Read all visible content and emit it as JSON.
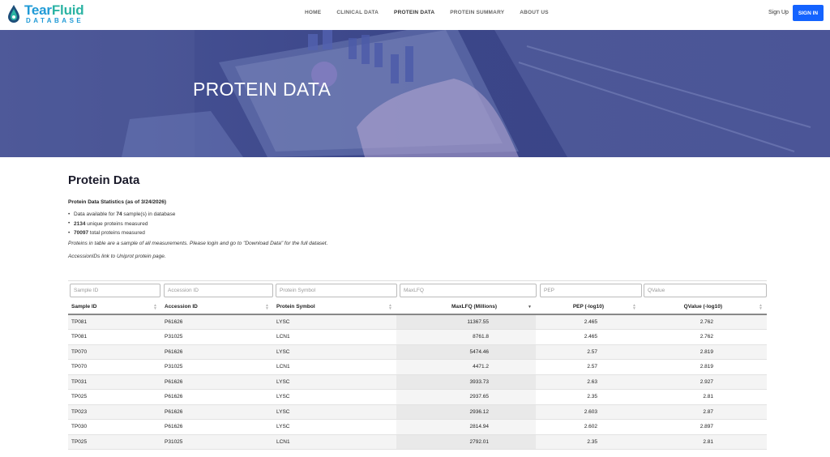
{
  "brand": {
    "title_main": "Tear",
    "title_accent": "Fluid",
    "subtitle": "DATABASE"
  },
  "nav": [
    {
      "label": "HOME",
      "active": false
    },
    {
      "label": "CLINICAL DATA",
      "active": false
    },
    {
      "label": "PROTEIN DATA",
      "active": true
    },
    {
      "label": "PROTEIN SUMMARY",
      "active": false
    },
    {
      "label": "ABOUT US",
      "active": false
    }
  ],
  "auth": {
    "signup": "Sign Up",
    "signin": "SIGN IN"
  },
  "hero": {
    "title": "PROTEIN DATA"
  },
  "main": {
    "title": "Protein Data",
    "stats_title": "Protein Data Statistics (as of 3/24/2026)",
    "stats": [
      {
        "prefix": "Data available for ",
        "value": "74",
        "suffix": " sample(s) in database"
      },
      {
        "prefix": "",
        "value": "2134",
        "suffix": " unique proteins measured"
      },
      {
        "prefix": "",
        "value": "70097",
        "suffix": " total proteins measured"
      }
    ],
    "note": "Proteins in table are a sample of all measurements. Please login and go to \"Download Data\" for the full dataset.",
    "note2": "AccessionIDs link to Uniprot protein page."
  },
  "table": {
    "filters": [
      "Sample ID",
      "Accession ID",
      "Protein Symbol",
      "MaxLFQ",
      "PEP",
      "QValue"
    ],
    "headers": [
      "Sample ID",
      "Accession ID",
      "Protein Symbol",
      "MaxLFQ (Millions)",
      "PEP (-log10)",
      "QValue (-log10)"
    ],
    "rows": [
      [
        "TP081",
        "P61626",
        "LYSC",
        "11367.55",
        "2.465",
        "2.762"
      ],
      [
        "TP081",
        "P31025",
        "LCN1",
        "8761.8",
        "2.465",
        "2.762"
      ],
      [
        "TP070",
        "P61626",
        "LYSC",
        "5474.46",
        "2.57",
        "2.819"
      ],
      [
        "TP070",
        "P31025",
        "LCN1",
        "4471.2",
        "2.57",
        "2.819"
      ],
      [
        "TP031",
        "P61626",
        "LYSC",
        "3933.73",
        "2.63",
        "2.927"
      ],
      [
        "TP025",
        "P61626",
        "LYSC",
        "2937.65",
        "2.35",
        "2.81"
      ],
      [
        "TP023",
        "P61626",
        "LYSC",
        "2936.12",
        "2.603",
        "2.87"
      ],
      [
        "TP030",
        "P61626",
        "LYSC",
        "2814.94",
        "2.602",
        "2.897"
      ],
      [
        "TP025",
        "P31025",
        "LCN1",
        "2792.01",
        "2.35",
        "2.81"
      ]
    ]
  },
  "colors": {
    "brand_blue": "#1f9ad6",
    "signin_bg": "#1463ff",
    "hero_overlay": "#3a4387"
  }
}
